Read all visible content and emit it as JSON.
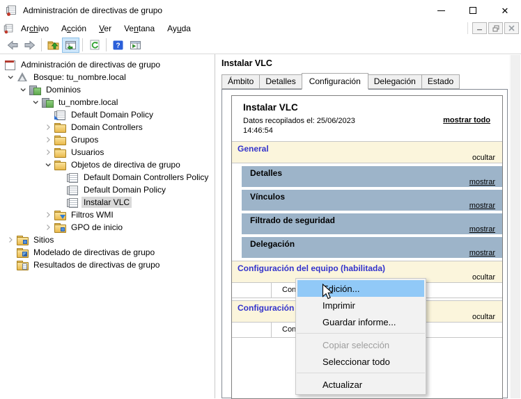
{
  "window": {
    "title": "Administración de directivas de grupo",
    "controls": [
      "minimize",
      "maximize",
      "close"
    ]
  },
  "menu_bar": {
    "items": [
      {
        "pre": "Ar",
        "acc": "ch",
        "post": "ivo"
      },
      {
        "pre": "A",
        "acc": "c",
        "post": "ción"
      },
      {
        "pre": "",
        "acc": "V",
        "post": "er"
      },
      {
        "pre": "Ve",
        "acc": "n",
        "post": "tana"
      },
      {
        "pre": "Ay",
        "acc": "u",
        "post": "da"
      }
    ],
    "mdi_controls": [
      "minimize",
      "restore",
      "close"
    ]
  },
  "toolbar": {
    "icons": [
      "back",
      "forward",
      "up-one-level-folder",
      "show-hide-console-tree",
      "refresh",
      "help",
      "show-hide-action-pane"
    ]
  },
  "tree": {
    "items": [
      {
        "label": "Administración de directivas de grupo"
      },
      {
        "label": "Bosque: tu_nombre.local"
      },
      {
        "label": "Dominios"
      },
      {
        "label": "tu_nombre.local"
      },
      {
        "label": "Default Domain Policy"
      },
      {
        "label": "Domain Controllers"
      },
      {
        "label": "Grupos"
      },
      {
        "label": "Usuarios"
      },
      {
        "label": "Objetos de directiva de grupo"
      },
      {
        "label": "Default Domain Controllers Policy"
      },
      {
        "label": "Default Domain Policy"
      },
      {
        "label": "Instalar VLC"
      },
      {
        "label": "Filtros WMI"
      },
      {
        "label": "GPO de inicio"
      },
      {
        "label": "Sitios"
      },
      {
        "label": "Modelado de directivas de grupo"
      },
      {
        "label": "Resultados de directivas de grupo"
      }
    ],
    "selected": "Instalar VLC"
  },
  "content": {
    "pane_title": "Instalar VLC",
    "tabs": [
      {
        "label": "Ámbito"
      },
      {
        "label": "Detalles"
      },
      {
        "label": "Configuración"
      },
      {
        "label": "Delegación"
      },
      {
        "label": "Estado"
      }
    ],
    "active_tab": "Configuración",
    "report": {
      "title": "Instalar VLC",
      "collected_line1": "Datos recopilados el: 25/06/2023",
      "collected_line2": "14:46:54",
      "show_all_link": "mostrar todo",
      "general": {
        "title": "General",
        "action": "ocultar"
      },
      "subsections": [
        {
          "title": "Detalles",
          "action": "mostrar"
        },
        {
          "title": "Vínculos",
          "action": "mostrar"
        },
        {
          "title": "Filtrado de seguridad",
          "action": "mostrar"
        },
        {
          "title": "Delegación",
          "action": "mostrar"
        }
      ],
      "computer": {
        "title": "Configuración del equipo (habilitada)",
        "action": "ocultar",
        "empty_text": "Configuración no definida"
      },
      "user": {
        "title": "Configuración de usuario (habilitada)",
        "action": "ocultar",
        "empty_text": "Configuración no definida"
      }
    }
  },
  "context_menu": {
    "items": [
      {
        "label": "Edición..."
      },
      {
        "label": "Imprimir"
      },
      {
        "label": "Guardar informe..."
      },
      {
        "label": "Copiar selección"
      },
      {
        "label": "Seleccionar todo"
      },
      {
        "label": "Actualizar"
      }
    ],
    "highlighted": "Edición...",
    "disabled": "Copiar selección"
  },
  "colors": {
    "section_header_bg": "#fbf5dc",
    "section_header_text": "#3333cc",
    "band_bg": "#9db4c9",
    "menu_highlight": "#91c9f7",
    "tree_selection": "#d9d9d9",
    "toolbar_toggle_bg": "#cde6fa"
  }
}
